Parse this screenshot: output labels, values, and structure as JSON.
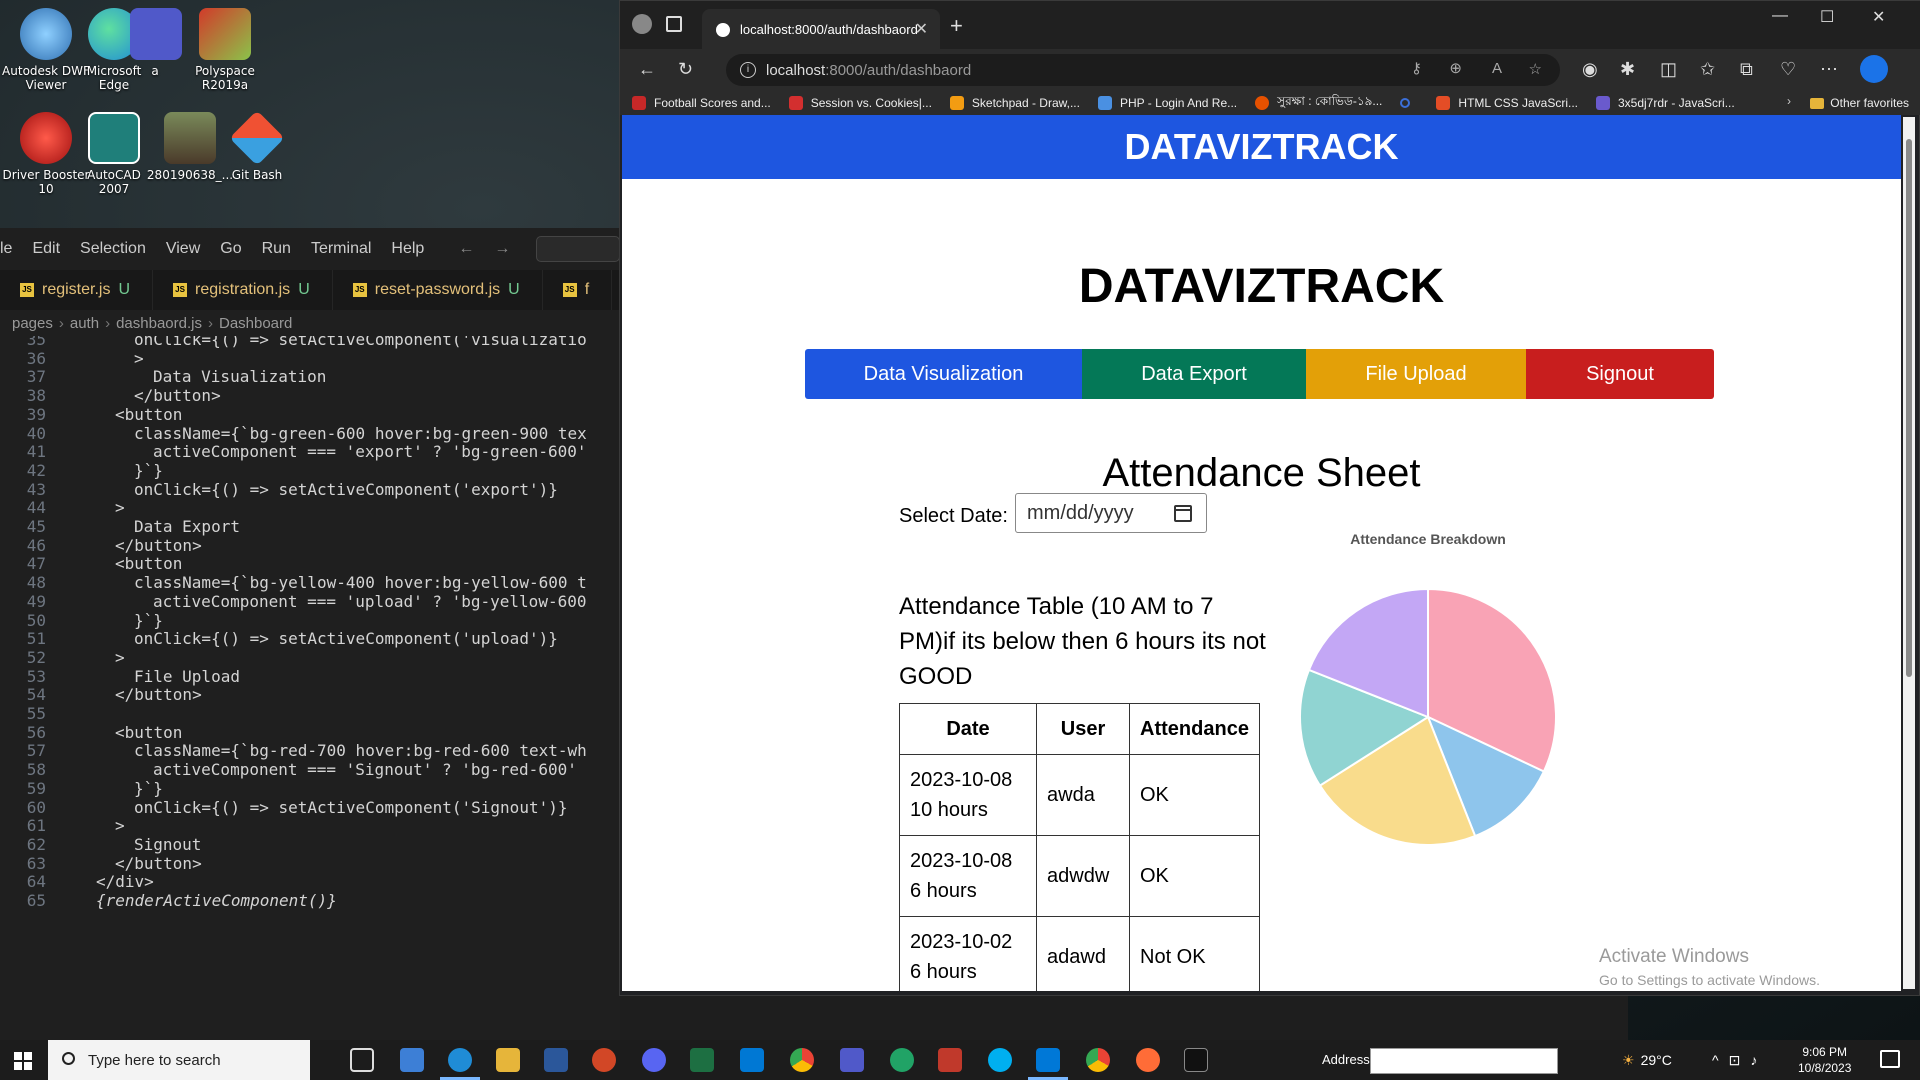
{
  "desktop": {
    "icons": [
      {
        "label": "Autodesk DWF Viewer",
        "color": "#2f6fb1"
      },
      {
        "label": "Microsoft Edge",
        "color": "#1f8cd6"
      },
      {
        "label": "a",
        "color": "#5059c9"
      },
      {
        "label": "Polyspace R2019a",
        "color": "#d23a2a"
      },
      {
        "label": "Driver Booster 10",
        "color": "#c8211f"
      },
      {
        "label": "AutoCAD 2007",
        "color": "#1f7f7a"
      },
      {
        "label": "280190638_...",
        "color": "#6b6a4a"
      },
      {
        "label": "Git Bash",
        "color": "#f05133"
      }
    ]
  },
  "vscode": {
    "menu": [
      "le",
      "Edit",
      "Selection",
      "View",
      "Go",
      "Run",
      "Terminal",
      "Help"
    ],
    "tabs": [
      {
        "label": "register.js",
        "status": "U"
      },
      {
        "label": "registration.js",
        "status": "U"
      },
      {
        "label": "reset-password.js",
        "status": "U"
      },
      {
        "label": "f",
        "status": ""
      }
    ],
    "breadcrumb": [
      "pages",
      "auth",
      "dashbaord.js",
      "Dashboard"
    ],
    "line_numbers": [
      "35",
      "36",
      "37",
      "38",
      "39",
      "40",
      "41",
      "42",
      "43",
      "44",
      "45",
      "46",
      "47",
      "48",
      "49",
      "50",
      "51",
      "52",
      "53",
      "54",
      "55",
      "56",
      "57",
      "58",
      "59",
      "60",
      "61",
      "62",
      "63",
      "64",
      "65"
    ],
    "lines": [
      "onClick={() => setActiveComponent('visualizatio",
      ">",
      "Data Visualization",
      "</button>",
      "<button",
      "className={`bg-green-600 hover:bg-green-900 tex",
      "activeComponent === 'export' ? 'bg-green-600'",
      "}`}",
      "onClick={() => setActiveComponent('export')}",
      ">",
      "Data Export",
      "</button>",
      "<button",
      "className={`bg-yellow-400 hover:bg-yellow-600 t",
      "activeComponent === 'upload' ? 'bg-yellow-600",
      "}`}",
      "onClick={() => setActiveComponent('upload')}",
      ">",
      "File Upload",
      "</button>",
      "",
      "<button",
      "className={`bg-red-700 hover:bg-red-600 text-wh",
      "activeComponent === 'Signout' ? 'bg-red-600'",
      "}`}",
      "onClick={() => setActiveComponent('Signout')}",
      ">",
      "Signout",
      "</button>",
      "</div>",
      "{renderActiveComponent()}"
    ]
  },
  "browser": {
    "tab_title": "localhost:8000/auth/dashbaord",
    "url_host": "localhost",
    "url_path": ":8000/auth/dashbaord",
    "bookmarks": [
      {
        "label": "Football Scores and...",
        "color": "#c62828"
      },
      {
        "label": "Session vs. Cookies|...",
        "color": "#d32f2f"
      },
      {
        "label": "Sketchpad - Draw,...",
        "color": "#f39c12"
      },
      {
        "label": "PHP - Login And Re...",
        "color": "#4a90e2"
      },
      {
        "label": "সুরক্ষা : কোভিড-১৯...",
        "color": "#e65100"
      },
      {
        "label": "",
        "color": "#3b6fd8"
      },
      {
        "label": "HTML CSS JavaScri...",
        "color": "#e44d26"
      },
      {
        "label": "3x5dj7rdr - JavaScri...",
        "color": "#6a5acd"
      }
    ],
    "other_favorites": "Other favorites"
  },
  "page": {
    "header_brand": "DATAVIZTRACK",
    "title": "DATAVIZTRACK",
    "nav_buttons": [
      {
        "label": "Data Visualization",
        "color": "#1e56e0"
      },
      {
        "label": "Data Export",
        "color": "#047857"
      },
      {
        "label": "File Upload",
        "color": "#e3a008"
      },
      {
        "label": "Signout",
        "color": "#c81e1e"
      }
    ],
    "section_title": "Attendance Sheet",
    "date_label": "Select Date:",
    "date_placeholder": "mm/dd/yyyy",
    "table_heading": "Attendance Table (10 AM to 7 PM)if its below then 6 hours its not GOOD",
    "table": {
      "headers": [
        "Date",
        "User",
        "Attendance"
      ],
      "rows": [
        {
          "date": "2023-10-08",
          "hours": "10 hours",
          "user": "awda",
          "attendance": "OK"
        },
        {
          "date": "2023-10-08",
          "hours": "6 hours",
          "user": "adwdw",
          "attendance": "OK"
        },
        {
          "date": "2023-10-02",
          "hours": "6 hours",
          "user": "adawd",
          "attendance": "Not OK"
        }
      ]
    },
    "chart_title": "Attendance Breakdown",
    "activate_line1": "Activate Windows",
    "activate_line2": "Go to Settings to activate Windows."
  },
  "chart_data": {
    "type": "pie",
    "title": "Attendance Breakdown",
    "values": [
      32,
      12,
      22,
      15,
      19
    ],
    "colors": [
      "#f9a3b5",
      "#8ec5ec",
      "#f9dc8c",
      "#90d4d2",
      "#c3a7f5"
    ]
  },
  "taskbar": {
    "search_placeholder": "Type here to search",
    "address_label": "Address",
    "temperature": "29°C",
    "time": "9:06 PM",
    "date": "10/8/2023"
  }
}
